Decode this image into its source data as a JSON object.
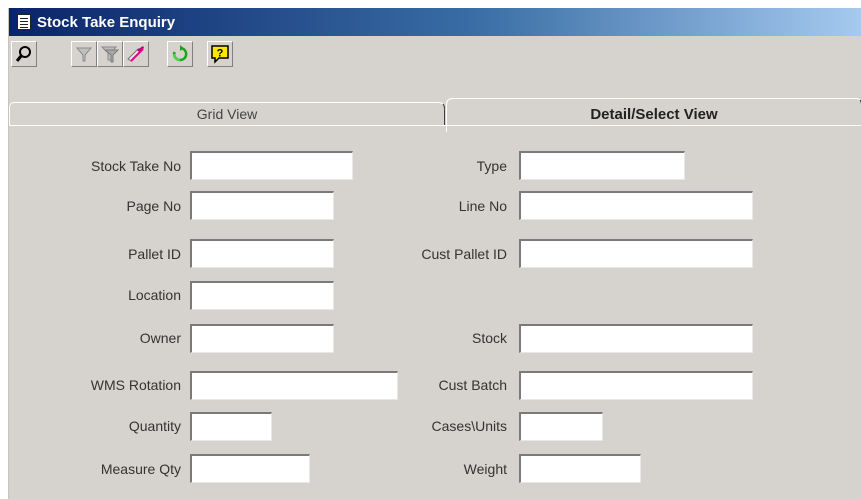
{
  "window": {
    "title": "Stock Take Enquiry"
  },
  "toolbar": {
    "buttons": [
      {
        "name": "search-button",
        "icon": "magnifier-icon"
      },
      {
        "name": "filter-button",
        "icon": "funnel-icon"
      },
      {
        "name": "filter-advanced-button",
        "icon": "funnel-multi-icon"
      },
      {
        "name": "clear-filter-button",
        "icon": "eraser-icon"
      },
      {
        "name": "refresh-button",
        "icon": "refresh-icon"
      },
      {
        "name": "help-button",
        "icon": "help-icon"
      }
    ]
  },
  "tabs": {
    "grid": "Grid View",
    "detail": "Detail/Select View"
  },
  "form": {
    "stock_take_no": {
      "label": "Stock Take No",
      "value": ""
    },
    "type": {
      "label": "Type",
      "value": ""
    },
    "page_no": {
      "label": "Page No",
      "value": ""
    },
    "line_no": {
      "label": "Line No",
      "value": ""
    },
    "pallet_id": {
      "label": "Pallet ID",
      "value": ""
    },
    "cust_pallet_id": {
      "label": "Cust Pallet ID",
      "value": ""
    },
    "location": {
      "label": "Location",
      "value": ""
    },
    "owner": {
      "label": "Owner",
      "value": ""
    },
    "stock": {
      "label": "Stock",
      "value": ""
    },
    "wms_rotation": {
      "label": "WMS Rotation",
      "value": ""
    },
    "cust_batch": {
      "label": "Cust Batch",
      "value": ""
    },
    "quantity": {
      "label": "Quantity",
      "value": ""
    },
    "cases_units": {
      "label": "Cases\\Units",
      "value": ""
    },
    "measure_qty": {
      "label": "Measure Qty",
      "value": ""
    },
    "weight": {
      "label": "Weight",
      "value": ""
    }
  },
  "colors": {
    "title_bar_start": "#0a246a",
    "title_bar_end": "#a6caf0",
    "face": "#d6d3ce"
  }
}
